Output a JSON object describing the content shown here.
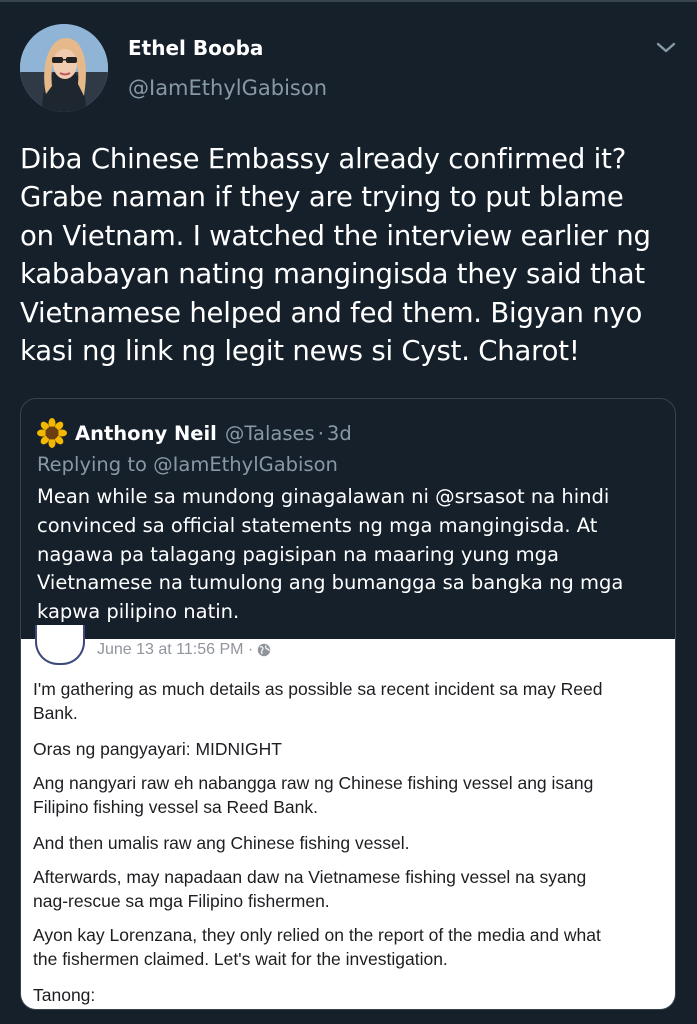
{
  "tweet": {
    "display_name": "Ethel Booba",
    "handle": "@IamEthylGabison",
    "text": "Diba Chinese Embassy already confirmed it?\nGrabe naman if they are trying to put blame\non Vietnam. I watched the interview earlier ng\nkababayan nating mangingisda they said that\nVietnamese helped and fed them. Bigyan nyo\nkasi ng link ng legit news si Cyst. Charot!"
  },
  "quoted": {
    "display_name": "Anthony Neil",
    "handle": "@Talases",
    "separator": "·",
    "time": "3d",
    "replying_to": "Replying to @IamEthylGabison",
    "text": "Mean while sa mundong ginagalawan ni @srsasot na hindi\nconvinced sa official statements ng mga mangingisda. At\nnagawa pa talagang pagisipan na maaring yung mga\nVietnamese na tumulong ang bumangga sa bangka ng mga\nkapwa pilipino natin."
  },
  "fb_post": {
    "timestamp": "June 13 at 11:56 PM ·",
    "paragraphs": [
      "I'm gathering as much details as possible sa recent incident sa may Reed\nBank.",
      "Oras ng pangyayari: MIDNIGHT",
      "Ang nangyari raw eh nabangga raw ng Chinese fishing vessel ang isang\nFilipino fishing vessel sa Reed Bank.",
      "And then umalis raw ang Chinese fishing vessel.",
      "Afterwards, may napadaan daw na Vietnamese fishing vessel na syang\nnag-rescue sa mga Filipino fishermen.",
      "Ayon kay Lorenzana, they only relied on the report of the media and what\nthe fishermen claimed. Let's wait for the investigation.",
      "Tanong:"
    ]
  },
  "icons": {
    "menu": "chevron-down-icon",
    "quoted_avatar": "sunflower-icon",
    "privacy": "globe-icon"
  },
  "colors": {
    "background": "#15202b",
    "secondary_text": "#8899a6",
    "border": "#38444d",
    "fb_meta": "#90949c"
  }
}
